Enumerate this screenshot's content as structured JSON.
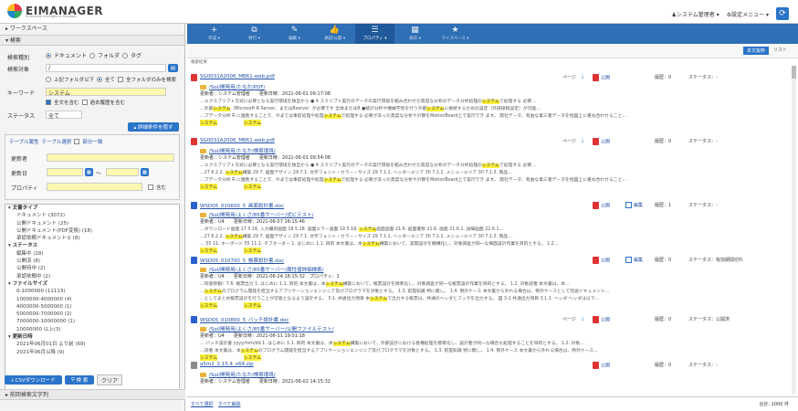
{
  "app": {
    "logo": "EIMANAGER",
    "logo_sub": "Enterprise Intelligence Manager"
  },
  "usermenu": {
    "user": "システム管理者 ▾",
    "settings": "設定メニュー ▾"
  },
  "left": {
    "workspace": "▸ ワークスペース",
    "search_h": "▾ 検索",
    "type_label": "検索種別",
    "type_opts": [
      "ドキュメント",
      "フォルダ",
      "タグ"
    ],
    "target_label": "検索対象",
    "target_value": "/",
    "scope_opts": [
      "上記フォルダ以下",
      "全て",
      "全フォルダのみを検索"
    ],
    "keyword_label": "キーワード",
    "keyword_value": "システム",
    "full_text": "全文を含む",
    "include_history": "過去履歴を含む",
    "status_label": "ステータス",
    "status_value": "全て",
    "detail_btn": "▴ 詳細条件を隠す",
    "attr_tabs": [
      "テーブル属性",
      "テーブル選択",
      "部分一致"
    ],
    "updater_label": "更新者",
    "date_label": "更新日",
    "date_sep": "〜",
    "property_label": "プロパティ",
    "property_chk": "含む",
    "csv_btn": "CSVダウンロード",
    "search_btn": "検 索",
    "clear_btn": "クリア",
    "history": "▸ 前回検索文字列",
    "facets": [
      {
        "h": "▾ 文書タイプ",
        "items": [
          "ドキュメント (3072)",
          "公開ドキュメント (25)",
          "公開ドキュメント(PDF変換) (18)",
          "承認依頼ドキュメント① (8)"
        ]
      },
      {
        "h": "▾ ステータス",
        "items": [
          "編集中 (28)",
          "公開済 (8)",
          "公開待中 (2)",
          "承認依頼中 (2)"
        ]
      },
      {
        "h": "▾ ファイルサイズ",
        "items": [
          "0-1000000 (11113)",
          "1000000-4000000 (4)",
          "4000000-5000000 (1)",
          "5000000-7000000 (2)",
          "7000000-10000000 (1)",
          "10000000 以上(3)"
        ]
      },
      {
        "h": "▾ 更新日時",
        "items": [
          "2021年06月01日 より前 (69)",
          "2021年06月以降 (9)"
        ]
      }
    ]
  },
  "toolbar": [
    {
      "icon": "+",
      "label": "作成 ▾"
    },
    {
      "icon": "⧉",
      "label": "移行 ▾"
    },
    {
      "icon": "✎",
      "label": "編集 ▾"
    },
    {
      "icon": "👍",
      "label": "承認/公開 ▾"
    },
    {
      "icon": "☰",
      "label": "プロパティ ▾",
      "active": true
    },
    {
      "icon": "▦",
      "label": "表示 ▾"
    },
    {
      "icon": "★",
      "label": "マイスペース ▾"
    }
  ],
  "sort": {
    "body_tab": "本文抜粋",
    "list_tab": "リスト"
  },
  "col_header": "検索結果",
  "results": [
    {
      "kind": "pdf",
      "title": "SG0031A2006_MB61-web.pdf",
      "path": "/Sol/開発用/たなか/PDF/",
      "meta": "更新者：システム管理者　　更新日時：2021-06-01 09:17:08",
      "snip": [
        "…エクスプリプト方式に必要となる実行環境を独自から ● 4 スクリプト実行のデータの実行環境を組み合わせた高度な分析のデータ分析処理のシステムで処理する 必要…",
        "…外部システム（Microsoft R Server、またはRserve）が必要です 全体またはR ●統計分析や機械学習を行う外部システムに接続するための設定（外部接続設定）が可能…",
        "…プデータ分析 R に連携することで、今までは事前処理や処理システムで処理する 必要があった高度な分析や計算をMotionBoard上で実行でき ます。 弊社データ、有益な第三者データを地図上に重ね合わせること…"
      ],
      "right_label": "ページ",
      "right_pub": "公開",
      "hist": "履歴：0",
      "status": "ステータス：-"
    },
    {
      "kind": "pdf",
      "title": "SG0031A2006_MB61-web.pdf",
      "path": "/Sol/開発用/たなか/検索環境/",
      "meta": "更新者：システム管理者　　更新日時：2021-06-01 09:54:08",
      "snip": [
        "…エクスプリプト方式に必要となる実行環境を独自から ● 4 スクリプト実行のデータの実行環境を組み合わせた高度な分析のデータ分析処理のシステムで処理する 必要…",
        "…27 6.2.2. システム構築 29 7. 画面デザイン 29 7.1. 文字フォント・カラー・サイズ 29 7.1.1. ヘッダーエリア 30 7.1.2. メニューエリア 30 7.1.3. 製品…",
        "…プデータ分析 R に連携することで、今までは事前処理や処理システムで処理する 必要があった高度な分析や計算をMotionBoard上で実行でき ます。 弊社データ、有益な第三者データを地図上に重ね合わせること…"
      ],
      "right_label": "ページ",
      "right_pub": "公開",
      "hist": "履歴：0",
      "status": "ステータス：-"
    },
    {
      "kind": "doc",
      "title": "WSD05_010600_5_画面設計書.doc",
      "path": "/Sol/開発用/よくさ/85番サーバー/式ビテスト/",
      "meta": "更新者：U4　　更新日時：2021-06-07 16:15:46",
      "snip": [
        "…ダウンロード画面 17 5.16. 入力欄的画面 18 5.18. 画面エラー画面 19 5.18. システム画面画面 21.6. 画面遷移 21.6. 画面 21.6.1. 詳細画面 22.6.1…",
        "…27 6.2.2. システム構築 29 7. 画面デザイン 29 7.1. 文字フォント・カラー・サイズ 29 7.1.1. ヘッダーエリア 30 7.1.2. メニューエリア 30 7.1.3. 製品…",
        "… 55 11. キーボード 55 11.1. タブオーダー 1. はじめに 1.1. 目的 本文書は、本システム構築において、実開設計を機構化し、対象調査が同一な場面設計作業を目的とする。 1.2…"
      ],
      "right_pub": "公開",
      "right_edit": "編集",
      "hist": "履歴：1",
      "status": "ステータス：-"
    },
    {
      "kind": "doc",
      "title": "WSD05_010700_5_帳票設計書.doc",
      "path": "/Sol/開発用/よくさ/85番サーバー/属性値詳細検索/",
      "meta": "更新者：U4　　更新日時：2021-06-24 16:15:32　プロパティ：1",
      "snip": [
        "…同意移動）7.6. 帳票出力 1. はじめに 1.1. 目的 本文書は、本システム構築において、帳票設計を標準化し、対象調査が同一な帳票設計作業を目的とする。 1.2. 対象読者 本文書は、本…",
        "…システムのプログラム開発を担当するアプリケーションエンジニア及びプログラマを対象とする。 1.3. 前提知識 特に無し。 1.4. 例外ケース 本文書から外れる場合は、例外ケースとして別途ドキュメント…",
        "…としてまとめ帳票設計を行うことが可能となるよう設計する。 3-1. 共通出力項目 本システムで出力する帳票は、共通のヘッダとフッタを出力する。 図 3-1 共通出力項目 3.1.1. ヘッダ ヘッダは以下…"
      ],
      "right_pub": "公開",
      "right_edit": "編集",
      "hist": "履歴：0",
      "status": "ステータス：有効期間切れ"
    },
    {
      "kind": "doc",
      "title": "WSD05_010800_5_バッチ設計書.doc",
      "path": "/Sol/開発用/よくさ/85番サーバー/公開ファイルテスト/",
      "meta": "更新者：U4　　更新日時：2021-06-11 19:01:18",
      "snip": [
        "… バッチ設計書 yyyy/mm/dd 1. はじめに 1.1. 目的 本文書は、本システム構築において、外部設計における各種処理を標準化し、設計者が同一な場合も処理することを目的とする。 1.2. 対象…",
        "…読者 本文書は、本システムのプログラム開発を担当するアプリケーションエンジニア及びプログラマを対象とする。 1.3. 前提知識 特に無し。 1.4. 例外ケース 本文書から外れる場合は、例外ケース…"
      ],
      "right_label": "ページ",
      "right_pub": "公開",
      "hist": "履歴：0",
      "status": "ステータス：公開済"
    },
    {
      "kind": "zip",
      "title": "a5m2_2.15.4_x64.zip",
      "path": "/Sol/開発用/たなか/検索環境/",
      "meta": "更新者：システム管理者　　更新日時：2021-06-02 14:15:32",
      "snip": [],
      "right_pub": "公開",
      "hist": "履歴：0",
      "status": "ステータス：-"
    }
  ],
  "footer": {
    "select_all": "すべて選択",
    "clear_all": "すべて解除",
    "total": "合計: 1000 件"
  },
  "colors": {
    "toolbar": "#2f6fb5",
    "highlight": "#fff23a",
    "input_yellow": "#fff8b0",
    "link": "#2150a8"
  }
}
